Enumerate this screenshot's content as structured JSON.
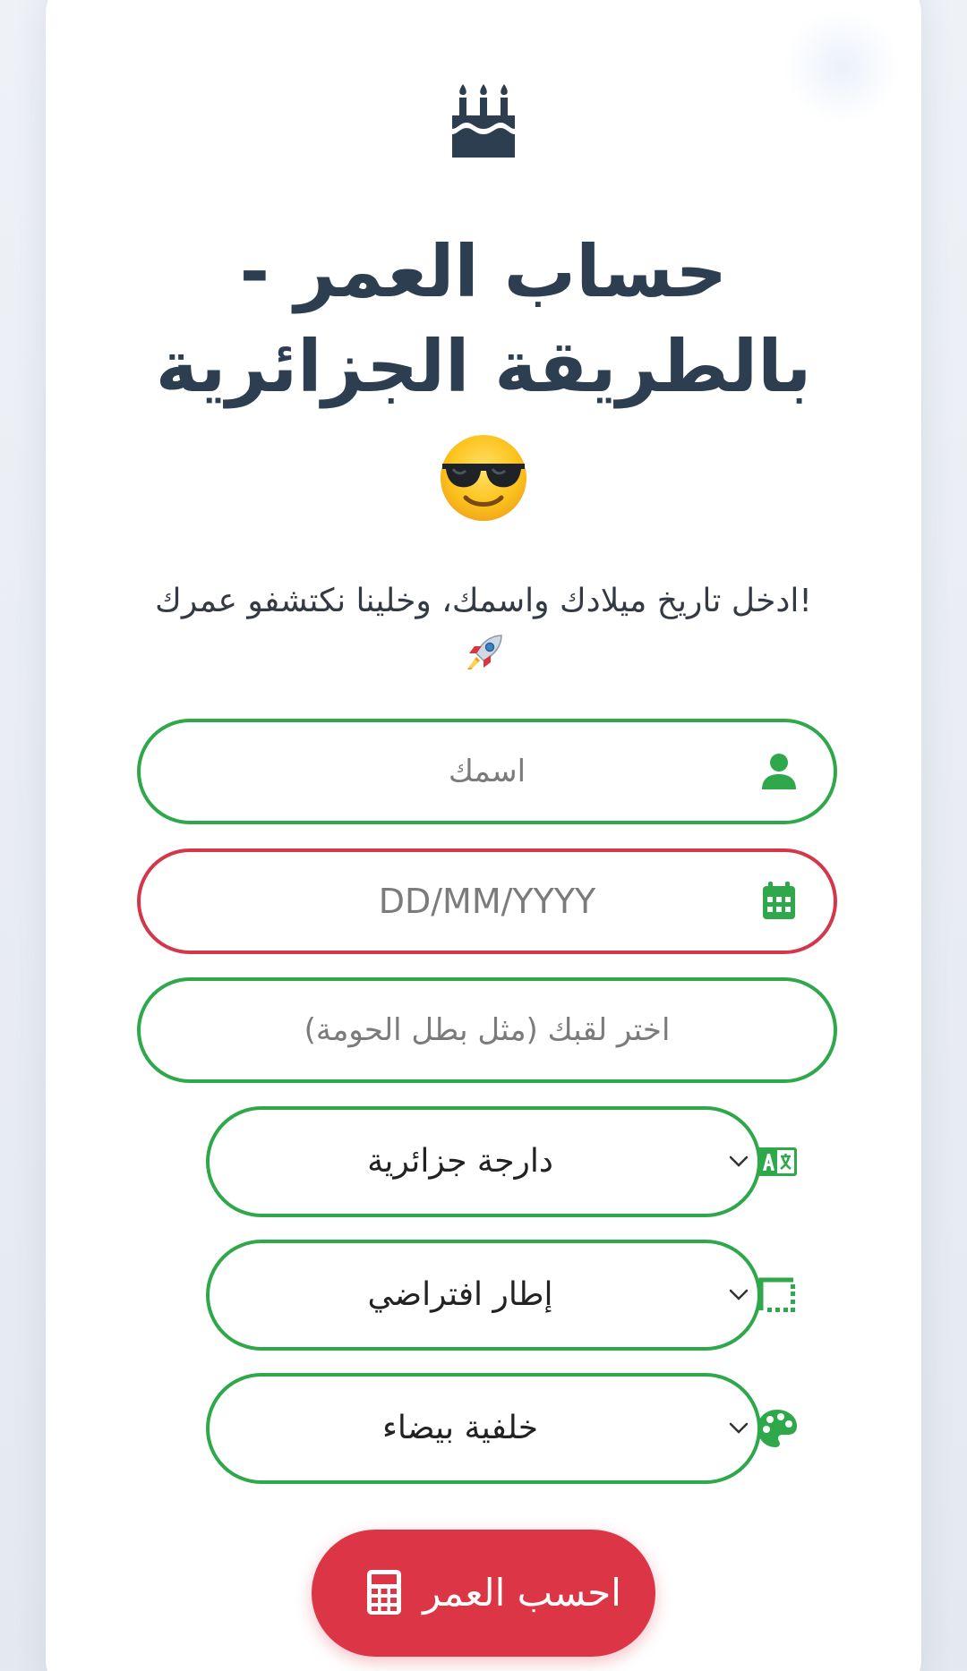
{
  "header": {
    "title_line1": "حساب العمر -",
    "title_line2": "بالطريقة الجزائرية",
    "subtitle": "!ادخل تاريخ ميلادك واسمك، وخلينا نكتشفو عمرك"
  },
  "icons": {
    "top": "birthday-cake-icon",
    "title_emoji": "smiling-face-with-sunglasses",
    "subtitle_emoji": "rocket"
  },
  "form": {
    "name_placeholder": "اسمك",
    "date_placeholder": "DD/MM/YYYY",
    "nickname_placeholder": "اختر لقبك (مثل بطل الحومة)",
    "language_value": "دارجة جزائرية",
    "frame_value": "إطار افتراضي",
    "background_value": "خلفية بيضاء"
  },
  "action": {
    "calculate_label": "احسب العمر"
  },
  "colors": {
    "primary_text": "#2c3e50",
    "accent_green": "#2ea84a",
    "error_red": "#d2384a",
    "button_red": "#dc3545"
  }
}
